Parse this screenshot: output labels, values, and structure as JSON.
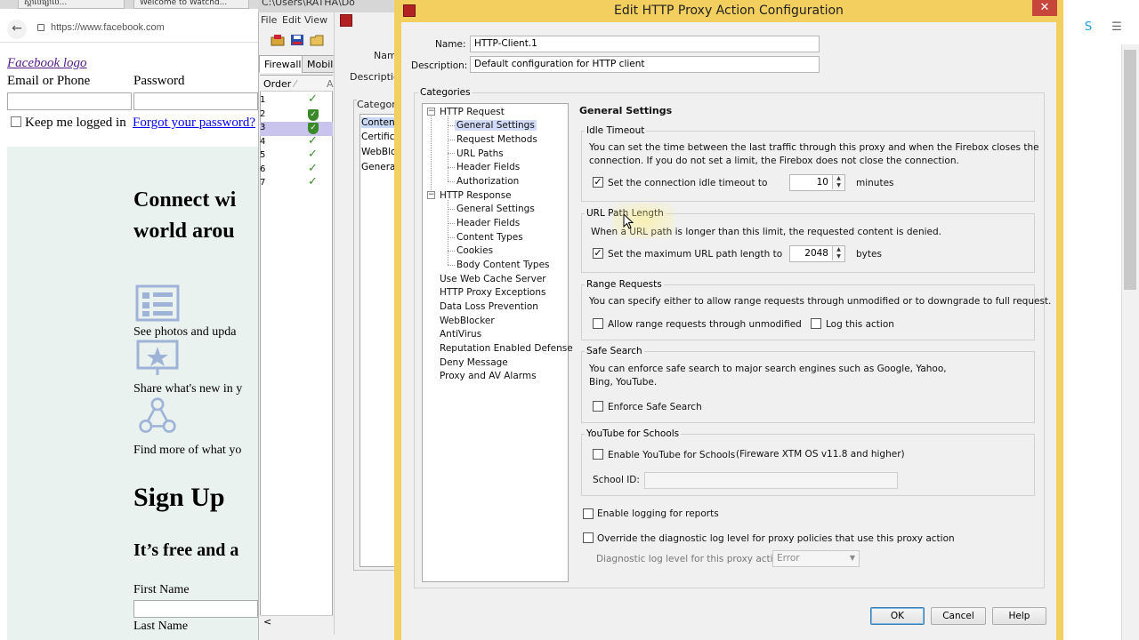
{
  "browser": {
    "tabs": [
      "ស្គាល់ផ្សាល...",
      "Welcome to Watchd..."
    ],
    "url": "https://www.facebook.com",
    "facebook": {
      "logo_alt": "Facebook logo",
      "email_label": "Email or Phone",
      "password_label": "Password",
      "keep_logged": "Keep me logged in",
      "forgot": "Forgot your password?",
      "connect_line1": "Connect wi",
      "connect_line2": "world arou",
      "feature1": "See photos and upda",
      "feature2": "Share what's new in y",
      "feature3": "Find more of what yo",
      "signup": "Sign Up",
      "free": "It’s free and a",
      "first_name": "First Name",
      "last_name": "Last Name"
    }
  },
  "policy_manager": {
    "title": "C:\\Users\\RATHA\\Do",
    "menu": [
      "File",
      "Edit",
      "View"
    ],
    "tabs": [
      "Firewall",
      "Mobile"
    ],
    "order_header": "Order",
    "rows": [
      "1",
      "2",
      "3",
      "4",
      "5",
      "6",
      "7"
    ],
    "name_label": "Nam",
    "description_label": "Descriptio",
    "categories_label": "Categori",
    "categories": [
      "Content",
      "Certifica",
      "WebBlo",
      "Genera"
    ],
    "scroll_left": "<"
  },
  "dialog": {
    "title": "Edit HTTP Proxy Action Configuration",
    "close": "✕",
    "name_label": "Name:",
    "name_value": "HTTP-Client.1",
    "description_label": "Description:",
    "description_value": "Default configuration for HTTP client",
    "categories_legend": "Categories",
    "tree": {
      "http_request": "HTTP Request",
      "request_children": [
        "General Settings",
        "Request Methods",
        "URL Paths",
        "Header Fields",
        "Authorization"
      ],
      "http_response": "HTTP Response",
      "response_children": [
        "General Settings",
        "Header Fields",
        "Content Types",
        "Cookies",
        "Body Content Types"
      ],
      "others": [
        "Use Web Cache Server",
        "HTTP Proxy Exceptions",
        "Data Loss Prevention",
        "WebBlocker",
        "AntiVirus",
        "Reputation Enabled Defense",
        "Deny Message",
        "Proxy and AV Alarms"
      ]
    },
    "section_title": "General Settings",
    "idle_timeout": {
      "legend": "Idle Timeout",
      "desc_line1": "You can set the time between the last traffic through this proxy and when the Firebox closes the",
      "desc_line2": "connection. If you do not set a limit, the Firebox does not close the connection.",
      "checkbox_label": "Set the connection idle timeout to",
      "value": "10",
      "unit": "minutes",
      "checked": "✓"
    },
    "url_path": {
      "legend": "URL Path Length",
      "desc": "When a URL path is longer than this limit, the requested content is denied.",
      "checkbox_label": "Set the maximum URL path length to",
      "value": "2048",
      "unit": "bytes",
      "checked": "✓"
    },
    "range_requests": {
      "legend": "Range Requests",
      "desc": "You can specify either to allow range requests through unmodified or to downgrade to full request.",
      "allow_label": "Allow range requests through unmodified",
      "log_label": "Log this action"
    },
    "safe_search": {
      "legend": "Safe Search",
      "desc_line1": "You can enforce safe search to major search engines such as Google, Yahoo,",
      "desc_line2": "Bing, YouTube.",
      "checkbox_label": "Enforce Safe Search"
    },
    "youtube": {
      "legend": "YouTube for Schools",
      "checkbox_label": "Enable YouTube for Schools",
      "note": "(Fireware XTM OS v11.8 and higher)",
      "school_id_label": "School ID:",
      "school_id_value": ""
    },
    "logging_label": "Enable logging for reports",
    "override_label": "Override the diagnostic log level for proxy policies that use this proxy action",
    "diag_label": "Diagnostic log level for this proxy action",
    "diag_value": "Error",
    "buttons": {
      "ok": "OK",
      "cancel": "Cancel",
      "help": "Help"
    }
  },
  "colors": {
    "dialog_frame": "#f3cf5f",
    "selection": "#d2dcf8",
    "close_button": "#c7463c",
    "check_green": "#3b8a2a"
  }
}
